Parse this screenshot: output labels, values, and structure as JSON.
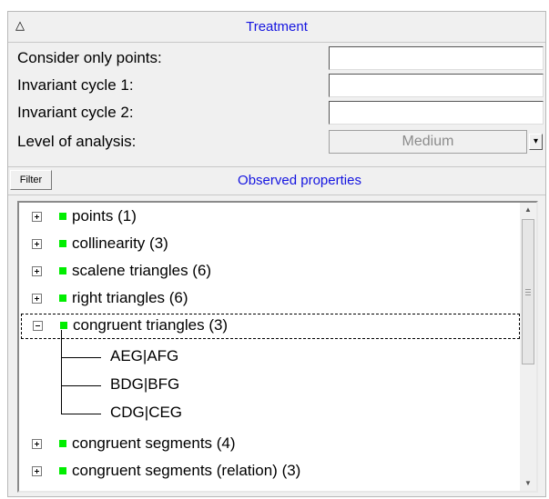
{
  "panel": {
    "collapse_icon": "triangle-up-icon",
    "title": "Treatment"
  },
  "fields": [
    {
      "label": "Consider only points:",
      "value": ""
    },
    {
      "label": "Invariant cycle 1:",
      "value": ""
    },
    {
      "label": "Invariant cycle 2:",
      "value": ""
    }
  ],
  "level": {
    "label": "Level of analysis:",
    "value": "Medium"
  },
  "observed": {
    "filter_label": "Filter",
    "title": "Observed properties"
  },
  "tree": {
    "items": [
      {
        "label": "points (1)",
        "expanded": false
      },
      {
        "label": "collinearity (3)",
        "expanded": false
      },
      {
        "label": "scalene triangles (6)",
        "expanded": false
      },
      {
        "label": "right triangles (6)",
        "expanded": false
      },
      {
        "label": "congruent triangles (3)",
        "expanded": true,
        "selected": true,
        "children": [
          "AEG|AFG",
          "BDG|BFG",
          "CDG|CEG"
        ]
      },
      {
        "label": "congruent segments (4)",
        "expanded": false
      },
      {
        "label": "congruent segments (relation) (3)",
        "expanded": false
      }
    ]
  },
  "colors": {
    "accent_text": "#1515e0",
    "status_dot": "#00ee00"
  }
}
